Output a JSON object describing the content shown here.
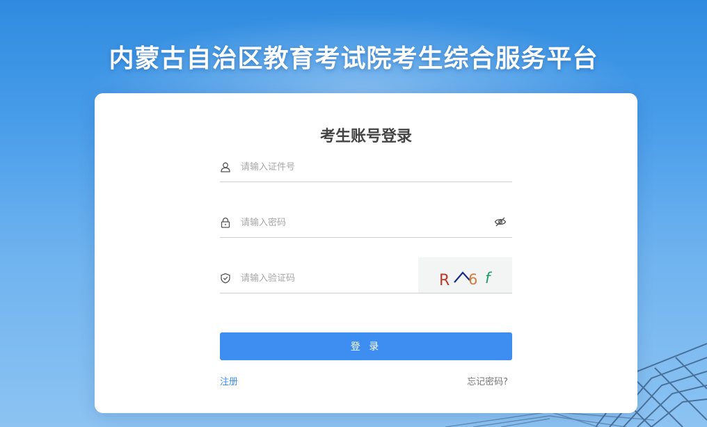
{
  "page": {
    "site_title": "内蒙古自治区教育考试院考生综合服务平台"
  },
  "login": {
    "title": "考生账号登录",
    "id_placeholder": "请输入证件号",
    "password_placeholder": "请输入密码",
    "captcha_placeholder": "请输入验证码",
    "captcha_text": [
      "R",
      "⁀",
      "6",
      "f"
    ],
    "submit_label": "登 录",
    "register_label": "注册",
    "forgot_label": "忘记密码?"
  },
  "colors": {
    "accent": "#3d8ef0",
    "background_top": "#2f8be0",
    "background_bottom": "#8cc3f2"
  },
  "icons": {
    "id": "user-icon",
    "password": "lock-icon",
    "captcha": "shield-check-icon",
    "password_toggle": "eye-off-icon"
  }
}
